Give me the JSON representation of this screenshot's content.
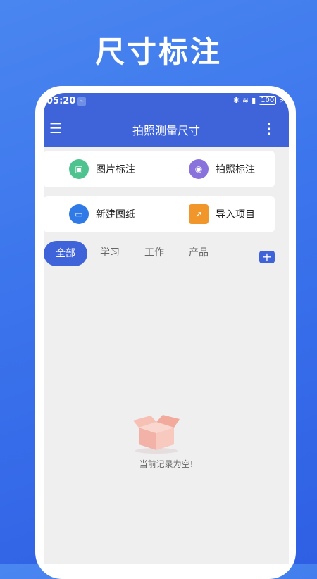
{
  "promo": {
    "title": "尺寸标注"
  },
  "statusbar": {
    "time": "05:20",
    "battery": "100"
  },
  "appbar": {
    "title": "拍照测量尺寸"
  },
  "actions": [
    {
      "label": "图片标注"
    },
    {
      "label": "拍照标注"
    },
    {
      "label": "新建图纸"
    },
    {
      "label": "导入项目"
    }
  ],
  "tabs": [
    "全部",
    "学习",
    "工作",
    "产品"
  ],
  "empty": {
    "text": "当前记录为空!"
  },
  "colors": {
    "accent": "#3f63d8",
    "green_icon": "#4fc38f",
    "purple_icon": "#8a72dc",
    "blue_icon": "#2f7ae6",
    "orange_icon": "#f0962a"
  }
}
